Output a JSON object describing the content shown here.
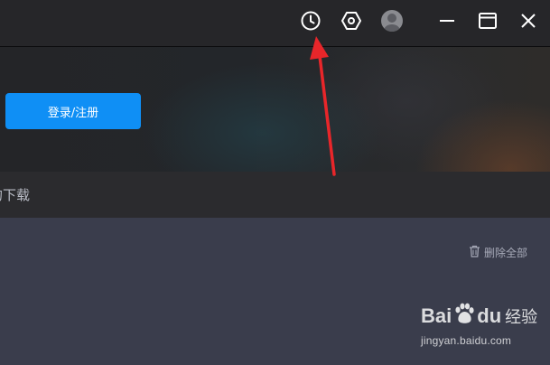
{
  "titlebar": {
    "icons": [
      "clock-icon",
      "settings-hexagon-icon",
      "avatar-icon",
      "minimize-icon",
      "maximize-icon",
      "close-icon"
    ]
  },
  "banner": {
    "login_label": "登录/注册"
  },
  "section": {
    "title": "的下载"
  },
  "content": {
    "delete_all_label": "删除全部",
    "delete_icon": "trash-icon"
  },
  "annotation": {
    "arrow_color": "#e8262a"
  },
  "watermark": {
    "brand_left": "Bai",
    "brand_right": "du",
    "brand_cn": "经验",
    "url": "jingyan.baidu.com"
  },
  "colors": {
    "accent": "#0f8ff5",
    "titlebar_bg": "#262629",
    "content_bg": "#3a3d4c"
  }
}
